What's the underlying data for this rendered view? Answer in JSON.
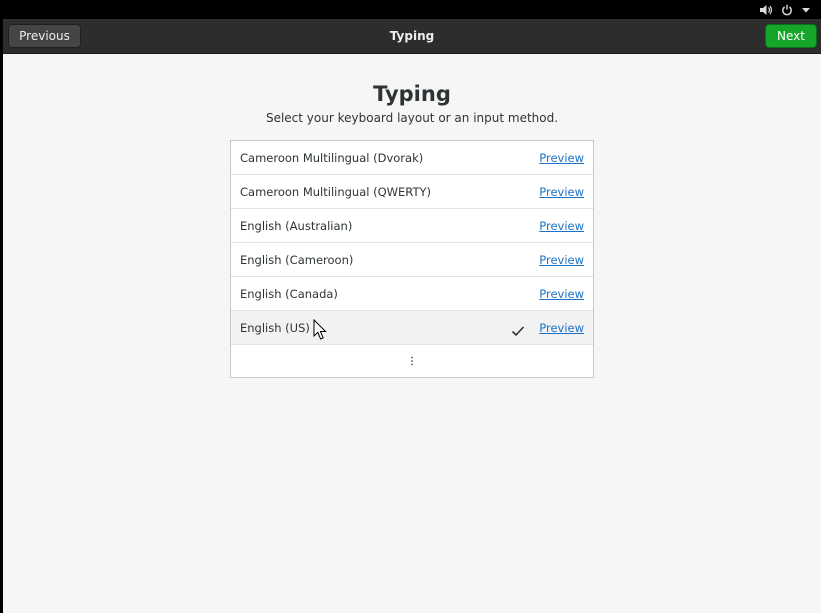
{
  "system_tray": {
    "volume_icon": "volume-icon",
    "power_icon": "power-icon",
    "menu_icon": "chevron-down-icon"
  },
  "header": {
    "title": "Typing",
    "previous_label": "Previous",
    "next_label": "Next"
  },
  "page": {
    "title": "Typing",
    "subtitle": "Select your keyboard layout or an input method."
  },
  "layouts": [
    {
      "label": "Cameroon Multilingual (Dvorak)",
      "action": "Preview",
      "selected": false
    },
    {
      "label": "Cameroon Multilingual (QWERTY)",
      "action": "Preview",
      "selected": false
    },
    {
      "label": "English (Australian)",
      "action": "Preview",
      "selected": false
    },
    {
      "label": "English (Cameroon)",
      "action": "Preview",
      "selected": false
    },
    {
      "label": "English (Canada)",
      "action": "Preview",
      "selected": false
    },
    {
      "label": "English (US)",
      "action": "Preview",
      "selected": true
    }
  ],
  "more_icon": "vertical-ellipsis-icon",
  "colors": {
    "accent_next": "#15a629",
    "link": "#1a73c8",
    "headerbar": "#2d2d2d",
    "background": "#f6f6f6"
  }
}
